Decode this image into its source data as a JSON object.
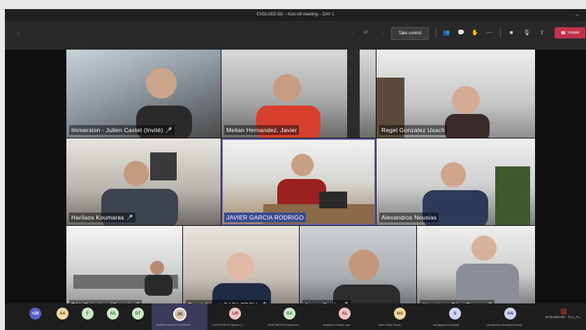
{
  "window": {
    "title": "EVOLVED-5G – Kick-off meeting – DAY 1",
    "minimize_glyph": "–"
  },
  "toolbar": {
    "menu_glyph": "⋮",
    "prev_glyph": "‹",
    "next_glyph": "›",
    "pagination": "of",
    "take_control_label": "Take control",
    "icons": [
      {
        "name": "participants-icon",
        "glyph": "👥"
      },
      {
        "name": "chat-icon",
        "glyph": "💬"
      },
      {
        "name": "raise-hand-icon",
        "glyph": "✋"
      },
      {
        "name": "more-options-icon",
        "glyph": "⋯"
      },
      {
        "name": "camera-icon",
        "glyph": "■"
      },
      {
        "name": "mic-icon",
        "glyph": "🎙"
      },
      {
        "name": "share-screen-icon",
        "glyph": "⇧"
      }
    ],
    "leave_label": "Leave",
    "leave_glyph": "☎",
    "leave_color": "#c4314b"
  },
  "tiles": [
    {
      "label": "Immersion - Julien Castet (Invité)",
      "mic_glyph": "🎤",
      "muted": true,
      "speaking": false
    },
    {
      "label": "Melian Hernandez, Javier",
      "mic_glyph": "",
      "muted": false,
      "speaking": false
    },
    {
      "label": "Regel Gonzalez Usach",
      "mic_glyph": "",
      "muted": false,
      "speaking": false
    },
    {
      "label": "Harilaos Koumaras",
      "mic_glyph": "🎤",
      "muted": true,
      "speaking": false
    },
    {
      "label": "JAVIER GARCIA RODRIGO",
      "mic_glyph": "",
      "muted": false,
      "speaking": true
    },
    {
      "label": "Alexandros Nousias",
      "mic_glyph": "",
      "muted": false,
      "speaking": false
    },
    {
      "label": "PAL Robotics (Guest)",
      "mic_glyph": "🎤",
      "muted": true,
      "speaking": false
    },
    {
      "label": "Tanel Järvet CAFA TECH",
      "mic_glyph": "🎤",
      "muted": true,
      "speaking": false
    },
    {
      "label": "Janez Sterle",
      "mic_glyph": "🎤",
      "muted": true,
      "speaking": false
    },
    {
      "label": "Almudena Díaz Zayas",
      "mic_glyph": "🎤",
      "muted": true,
      "speaking": false
    }
  ],
  "bottom_bar": {
    "overflow_count": "+28",
    "avatars": [
      {
        "initials": "AA",
        "color": "#f4d9a6",
        "text": "#6b4a10",
        "name": ""
      },
      {
        "initials": "F",
        "color": "#cfe8c9",
        "text": "#2e6b2a",
        "name": ""
      },
      {
        "initials": "AS",
        "color": "#cfe8c9",
        "text": "#2e6b2a",
        "name": ""
      },
      {
        "initials": "DT",
        "color": "#cfe8c9",
        "text": "#2e6b2a",
        "name": ""
      },
      {
        "initials": "LM",
        "color": "#f2c3c3",
        "text": "#8a2b2b",
        "name": "LOGOTHETIS Marios (..."
      },
      {
        "initials": "GA",
        "color": "#cfe8c9",
        "text": "#2e6b2a",
        "name": "GEROMITSOS Antonios..."
      },
      {
        "initials": "AL",
        "color": "#f2c3c3",
        "text": "#8a2b2b",
        "name": "Alejandro Fornés Leal"
      },
      {
        "initials": "MS",
        "color": "#f4d9a6",
        "text": "#6b4a10",
        "name": "Marc Oliver Sams"
      },
      {
        "initials": "S",
        "color": "#cfd6f2",
        "text": "#2f3f8a",
        "name": "sanakgrimon (Guest)"
      },
      {
        "initials": "AN",
        "color": "#cfd6f2",
        "text": "#2f3f8a",
        "name": "Alexandros Nousias (Guest)"
      }
    ],
    "presenter": {
      "name": "JAVIER GARCIA RODRIGO",
      "initials": "JG"
    },
    "file": {
      "glyph": "▤",
      "label": "EVOLVED-5G - T1.1_T1..."
    }
  }
}
